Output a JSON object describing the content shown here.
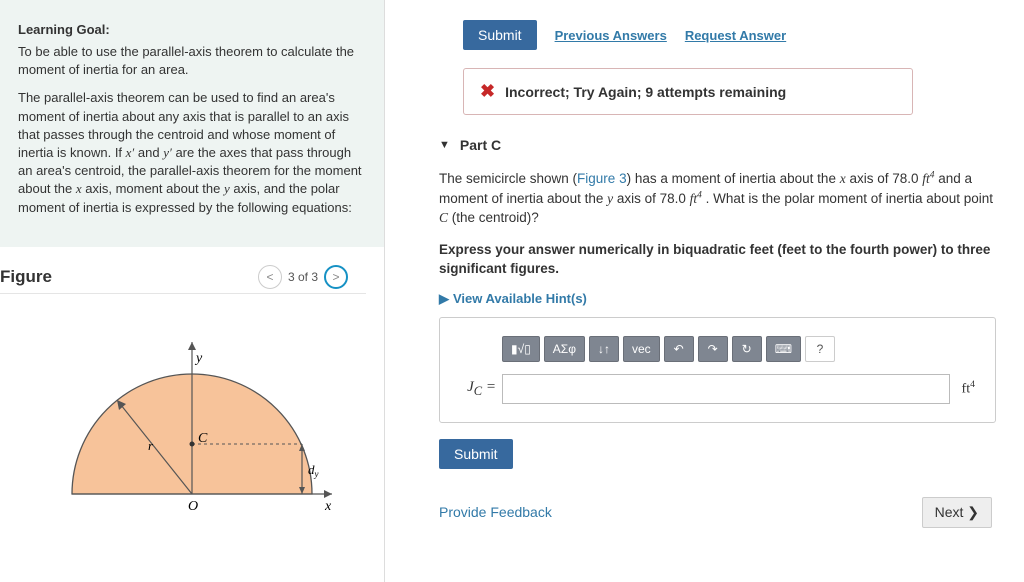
{
  "learning_goal": {
    "heading": "Learning Goal:",
    "p1": "To be able to use the parallel-axis theorem to calculate the moment of inertia for an area.",
    "p2_a": "The parallel-axis theorem can be used to find an area's moment of inertia about any axis that is parallel to an axis that passes through the centroid and whose moment of inertia is known. If ",
    "p2_b": " and ",
    "p2_c": " are the axes that pass through an area's centroid, the parallel-axis theorem for the moment about the ",
    "p2_d": " axis, moment about the ",
    "p2_e": " axis, and the polar moment of inertia is expressed by the following equations:",
    "xprime": "x′",
    "yprime": "y′",
    "x": "x",
    "y": "y"
  },
  "figure": {
    "title": "Figure",
    "pager": "3 of 3",
    "prev": "<",
    "next": ">",
    "labels": {
      "x": "x",
      "y": "y",
      "r": "r",
      "C": "C",
      "O": "O",
      "dy": "d"
    }
  },
  "submit_row": {
    "submit": "Submit",
    "prev": "Previous Answers",
    "req": "Request Answer"
  },
  "alert": {
    "icon": "✖",
    "text": "Incorrect; Try Again; 9 attempts remaining"
  },
  "partC": {
    "caret": "▼",
    "title": "Part C",
    "t1": "The semicircle shown (",
    "figlink": "Figure 3",
    "t2": ") has a moment of inertia about the ",
    "xaxis": "x",
    "t3": " axis of 78.0 ",
    "unit1": "ft",
    "t4": " and a moment of inertia about the ",
    "yaxis": "y",
    "t5": " axis of 78.0 ",
    "t6": " . What is the polar moment of inertia about point ",
    "Cpt": "C",
    "t7": " (the centroid)?",
    "instr": "Express your answer numerically in biquadratic feet (feet to the fourth power) to three significant figures.",
    "hint_caret": "▶",
    "hint": "View Available Hint(s)",
    "toolbar": {
      "b1": "▮√▯",
      "b2": "ΑΣφ",
      "b3": "↓↑",
      "b4": "vec",
      "b5": "↶",
      "b6": "↷",
      "b7": "↻",
      "b8": "⌨",
      "b9": "?"
    },
    "lhs_a": "J",
    "lhs_b": "C",
    "lhs_c": " = ",
    "unit_a": "ft",
    "submit": "Submit"
  },
  "footer": {
    "feedback": "Provide Feedback",
    "next": "Next ❯"
  }
}
